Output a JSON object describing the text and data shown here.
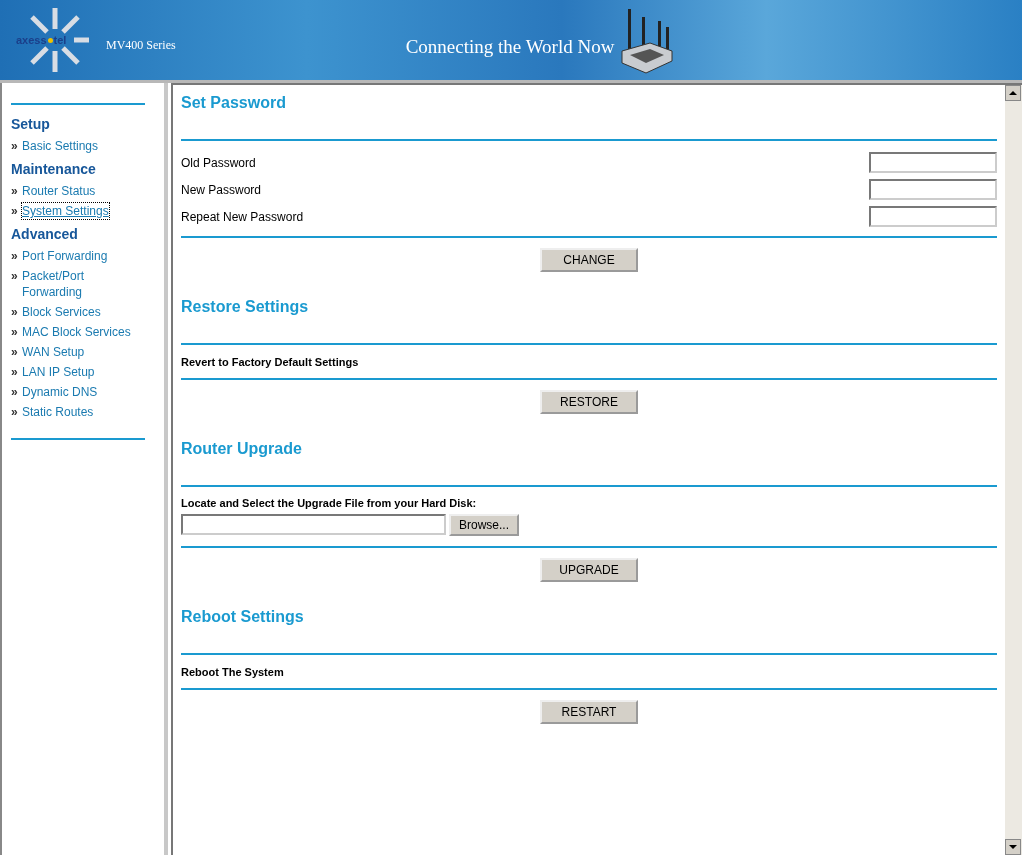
{
  "header": {
    "logo": {
      "left": "axess",
      "right": "tel"
    },
    "series": "MV400 Series",
    "tagline": "Connecting the World Now"
  },
  "sidebar": {
    "groups": [
      {
        "heading": "Setup",
        "items": [
          {
            "label": "Basic Settings",
            "selected": false
          }
        ]
      },
      {
        "heading": "Maintenance",
        "items": [
          {
            "label": "Router Status",
            "selected": false
          },
          {
            "label": "System Settings",
            "selected": true
          }
        ]
      },
      {
        "heading": "Advanced",
        "items": [
          {
            "label": "Port Forwarding",
            "selected": false
          },
          {
            "label": "Packet/Port Forwarding",
            "selected": false
          },
          {
            "label": "Block Services",
            "selected": false
          },
          {
            "label": "MAC Block Services",
            "selected": false
          },
          {
            "label": "WAN Setup",
            "selected": false
          },
          {
            "label": "LAN IP Setup",
            "selected": false
          },
          {
            "label": "Dynamic DNS",
            "selected": false
          },
          {
            "label": "Static Routes",
            "selected": false
          }
        ]
      }
    ],
    "bullet": "»"
  },
  "sections": [
    {
      "kind": "fields",
      "title": "Set Password",
      "fields": [
        "Old Password",
        "New Password",
        "Repeat New Password"
      ],
      "button": "CHANGE"
    },
    {
      "kind": "text",
      "title": "Restore Settings",
      "text": "Revert to Factory Default Settings",
      "button": "RESTORE"
    },
    {
      "kind": "file",
      "title": "Router Upgrade",
      "text": "Locate and Select the Upgrade File from your Hard Disk:",
      "browse": "Browse...",
      "button": "UPGRADE"
    },
    {
      "kind": "text",
      "title": "Reboot Settings",
      "text": "Reboot The System",
      "button": "RESTART"
    }
  ]
}
